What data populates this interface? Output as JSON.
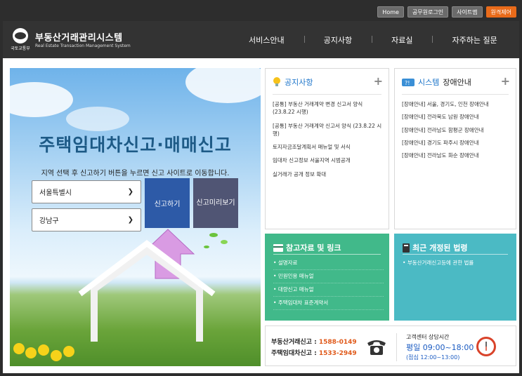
{
  "util": {
    "buttons": [
      "Home",
      "공무원로그인",
      "사이트맵",
      "원격제어"
    ]
  },
  "header": {
    "logo_caption": "국토교통부",
    "title": "부동산거래관리시스템",
    "subtitle": "Real Estate Transaction Management System",
    "nav": [
      "서비스안내",
      "공지사항",
      "자료실",
      "자주하는 질문"
    ]
  },
  "hero": {
    "title": "주택임대차신고·매매신고",
    "description": "지역 선택 후 신고하기 버튼을 누르면 신고 사이트로 이동합니다.",
    "select_city": "서울특별시",
    "select_district": "강남구",
    "report_button": "신고하기",
    "preview_line1": "신고",
    "preview_line2": "미리보기"
  },
  "notice": {
    "title": "공지사항",
    "items": [
      "[공통] 부동산 거래계약 변경 신고서 양식 (23.8.22 시행)",
      "[공통] 부동산 거래계약 신고서 양식 (23.8.22 시행)",
      "토지자금조달계획서 매뉴얼 및 서식",
      "임대차 신고정보 서울지역 시범공개",
      "실거래가 공개 정보 확대"
    ]
  },
  "fault": {
    "title_blue": "시스템",
    "title_dark": "장애안내",
    "items": [
      "[장애안내] 서울, 경기도, 인천 장애안내",
      "[장애안내] 전라북도 남원 장애안내",
      "[장애안내] 전라남도 함평군 장애안내",
      "[장애안내] 경기도 파주시 장애안내",
      "[장애안내] 전라남도 화순 장애안내"
    ]
  },
  "reference": {
    "title": "참고자료 및 링크",
    "items": [
      "설명자료",
      "민원인용 매뉴얼",
      "대량신고 매뉴얼",
      "주택임대차 표준계약서"
    ]
  },
  "laws": {
    "title": "최근 개정된 법령",
    "items": [
      "부동산거래신고등에 관한 법률"
    ]
  },
  "contact": {
    "line1_label": "부동산거래신고 : ",
    "line1_num": "1588-0149",
    "line2_label": "주택임대차신고 : ",
    "line2_num": "1533-2949",
    "center_title": "고객센터 상담시간",
    "hours": "평일 09:00~18:00",
    "lunch": "(점심 12:00~13:00)"
  }
}
